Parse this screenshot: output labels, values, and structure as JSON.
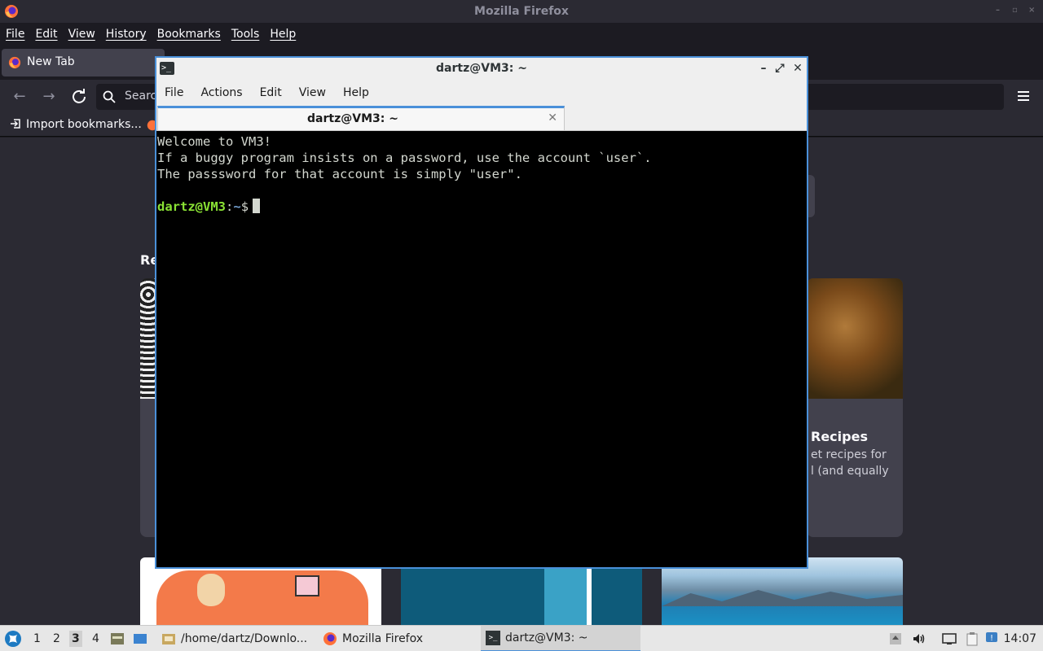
{
  "firefox": {
    "window_title": "Mozilla Firefox",
    "menu": [
      "File",
      "Edit",
      "View",
      "History",
      "Bookmarks",
      "Tools",
      "Help"
    ],
    "tab_label": "New Tab",
    "url_placeholder": "Searc",
    "bookmark_label": "Import bookmarks...",
    "recent_heading": "Re",
    "card_title": "Recipes",
    "card_text_line1": "et recipes for",
    "card_text_line2": "l (and equally"
  },
  "terminal": {
    "window_title": "dartz@VM3: ~",
    "menu": [
      "File",
      "Actions",
      "Edit",
      "View",
      "Help"
    ],
    "tab_title": "dartz@VM3: ~",
    "lines": [
      "Welcome to VM3!",
      "If a buggy program insists on a password, use the account `user`.",
      "The passsword for that account is simply \"user\"."
    ],
    "prompt_user": "dartz@VM3",
    "prompt_sep": ":",
    "prompt_path": "~",
    "prompt_symbol": "$"
  },
  "taskbar": {
    "workspaces": [
      "1",
      "2",
      "3",
      "4"
    ],
    "active_workspace": "3",
    "tasks": [
      {
        "label": "/home/dartz/Downlo...",
        "icon": "folder-icon"
      },
      {
        "label": "Mozilla Firefox",
        "icon": "firefox-icon"
      },
      {
        "label": "dartz@VM3: ~",
        "icon": "terminal-icon"
      }
    ],
    "clock": "14:07"
  },
  "colors": {
    "accent": "#4a90d9",
    "prompt_user": "#8ae234",
    "prompt_path": "#729fcf",
    "firefox_bg": "#2b2a33"
  }
}
